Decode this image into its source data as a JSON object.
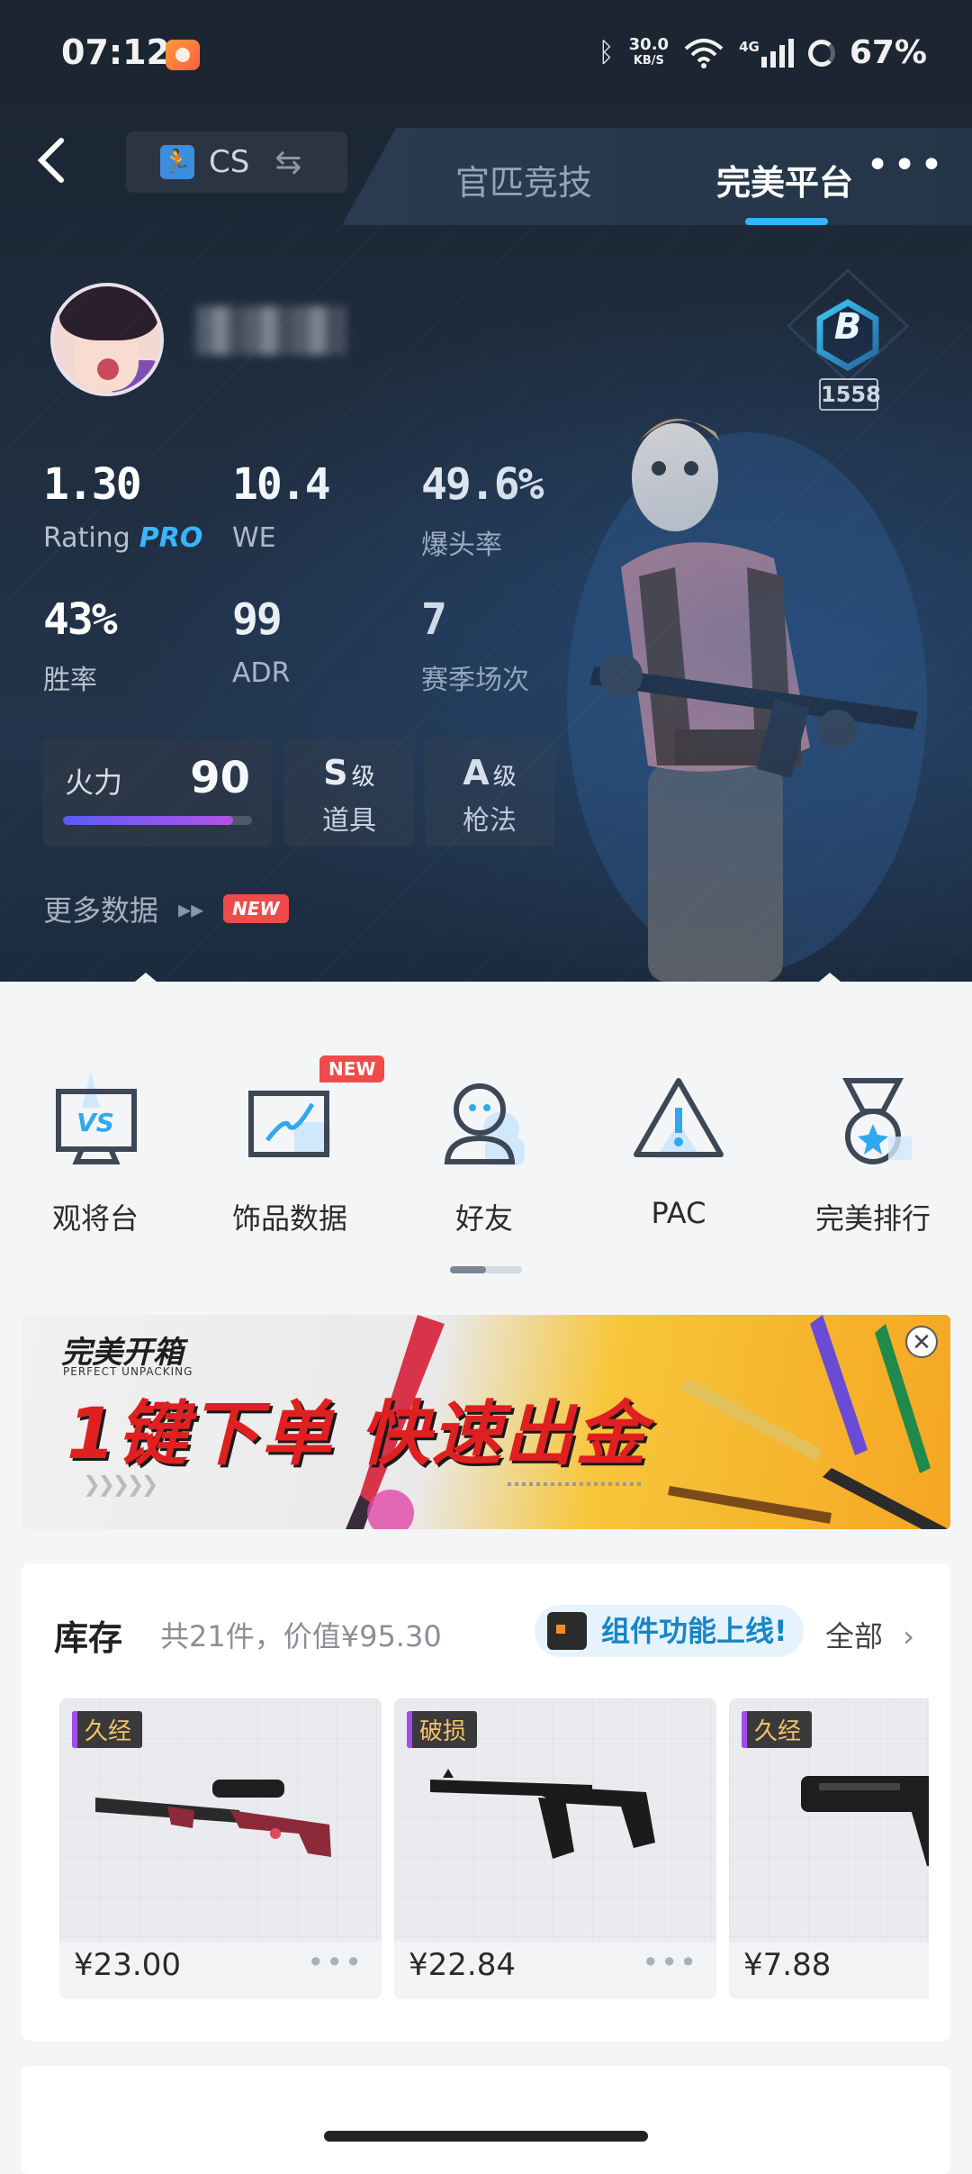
{
  "status_bar": {
    "time": "07:12",
    "speed_value": "30.0",
    "speed_unit": "KB/S",
    "network": "4G",
    "battery": "67%"
  },
  "nav": {
    "back_icon": "chevron-left-icon",
    "game_name": "CS",
    "swap_icon": "swap-icon",
    "tabs": [
      "官匹竞技",
      "完美平台"
    ],
    "active_tab": 1,
    "more_icon": "more-dots-icon"
  },
  "profile": {
    "rank_letter": "B",
    "rank_score": "1558"
  },
  "stats": [
    {
      "value": "1.30",
      "label": "Rating",
      "badge": "PRO"
    },
    {
      "value": "10.4",
      "label": "WE"
    },
    {
      "value": "49.6%",
      "label": "爆头率"
    },
    {
      "value": "43%",
      "label": "胜率"
    },
    {
      "value": "99",
      "label": "ADR"
    },
    {
      "value": "7",
      "label": "赛季场次"
    }
  ],
  "firepower": {
    "label": "火力",
    "value": "90",
    "level": 0.9
  },
  "grades": [
    {
      "grade": "S",
      "suffix": "级",
      "label": "道具"
    },
    {
      "grade": "A",
      "suffix": "级",
      "label": "枪法"
    }
  ],
  "more_data": {
    "label": "更多数据",
    "badge": "NEW"
  },
  "shortcuts": [
    {
      "label": "观将台",
      "icon": "vs-monitor-icon"
    },
    {
      "label": "饰品数据",
      "icon": "chart-board-icon",
      "badge": "NEW"
    },
    {
      "label": "好友",
      "icon": "friend-icon"
    },
    {
      "label": "PAC",
      "icon": "warning-triangle-icon"
    },
    {
      "label": "完美排行",
      "icon": "medal-icon"
    }
  ],
  "banner": {
    "brand": "完美开箱",
    "brand_sub": "PERFECT UNPACKING",
    "slogan": "1键下单 快速出金",
    "close_icon": "close-icon"
  },
  "inventory": {
    "title": "库存",
    "summary": "共21件，价值¥95.30",
    "promo": "组件功能上线!",
    "all_label": "全部",
    "items": [
      {
        "wear": "久经",
        "price": "¥23.00"
      },
      {
        "wear": "破损",
        "price": "¥22.84"
      },
      {
        "wear": "久经",
        "price": "¥7.88"
      }
    ]
  },
  "colors": {
    "accent": "#2fb6ff",
    "badge_red": "#f04a4a",
    "pro_blue": "#3ab7ff"
  }
}
